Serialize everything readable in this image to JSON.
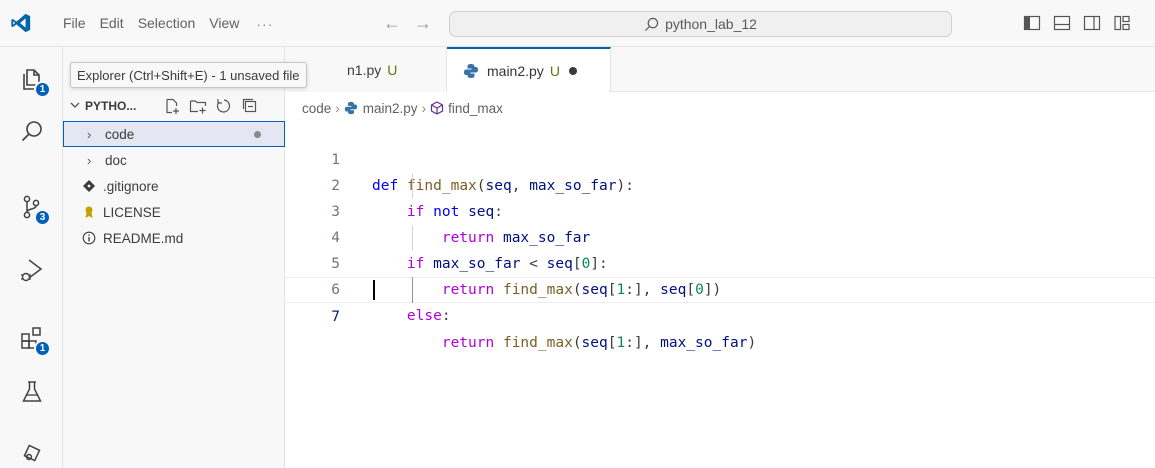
{
  "menu": {
    "items": [
      "File",
      "Edit",
      "Selection",
      "View"
    ],
    "more": "···"
  },
  "nav": {
    "back": "←",
    "forward": "→"
  },
  "command_center": {
    "text": "python_lab_12"
  },
  "activity_bar": {
    "explorer_badge": "1",
    "scm_badge": "3",
    "extensions_badge": "1"
  },
  "tooltip": {
    "text": "Explorer (Ctrl+Shift+E) - 1 unsaved file"
  },
  "sidebar": {
    "title": "PYTHO...",
    "tree": [
      {
        "label": "code",
        "type": "folder",
        "twisty": "›"
      },
      {
        "label": "doc",
        "type": "folder",
        "twisty": "›"
      },
      {
        "label": ".gitignore",
        "type": "file"
      },
      {
        "label": "LICENSE",
        "type": "file"
      },
      {
        "label": "README.md",
        "type": "file"
      }
    ]
  },
  "tabs": [
    {
      "label": "n1.py",
      "status": "U"
    },
    {
      "label": "main2.py",
      "status": "U"
    }
  ],
  "breadcrumb": {
    "folder": "code",
    "file": "main2.py",
    "symbol": "find_max",
    "sep": "›"
  },
  "editor": {
    "line_numbers": [
      "1",
      "2",
      "3",
      "4",
      "5",
      "6",
      "7"
    ],
    "lines": [
      "def find_max(seq, max_so_far):",
      "    if not seq:",
      "        return max_so_far",
      "    if max_so_far < seq[0]:",
      "        return find_max(seq[1:], seq[0])",
      "    else:",
      "        return find_max(seq[1:], max_so_far)"
    ]
  },
  "colors": {
    "accent": "#005fb8",
    "keyword": "#af00db",
    "def": "#0000ff",
    "function": "#795e26",
    "identifier": "#001080",
    "number": "#098658",
    "untracked": "#587c0c"
  }
}
